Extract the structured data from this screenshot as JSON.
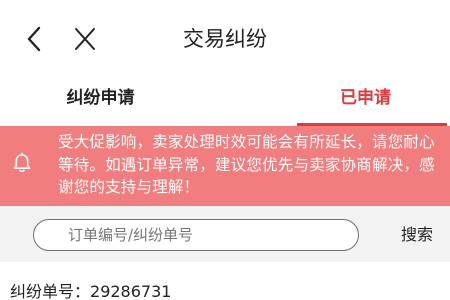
{
  "header": {
    "title": "交易纠纷",
    "back_icon": "chevron-left-icon",
    "close_icon": "close-icon"
  },
  "tabs": [
    {
      "label": "纠纷申请",
      "active": false
    },
    {
      "label": "已申请",
      "active": true
    }
  ],
  "notice": {
    "icon": "bell-icon",
    "text": "受大促影响，卖家处理时效可能会有所延长，请您耐心等待。如遇订单异常，建议您优先与卖家协商解决，感谢您的支持与理解！"
  },
  "search": {
    "placeholder": "订单编号/纠纷单号",
    "value": "",
    "button_label": "搜索"
  },
  "disputes": [
    {
      "label": "纠纷单号：",
      "number": "29286731"
    }
  ],
  "colors": {
    "accent": "#e4393c",
    "notice_background": "#f17d7e",
    "notice_text": "#ffffff",
    "search_row_background": "#f3f3f3"
  }
}
